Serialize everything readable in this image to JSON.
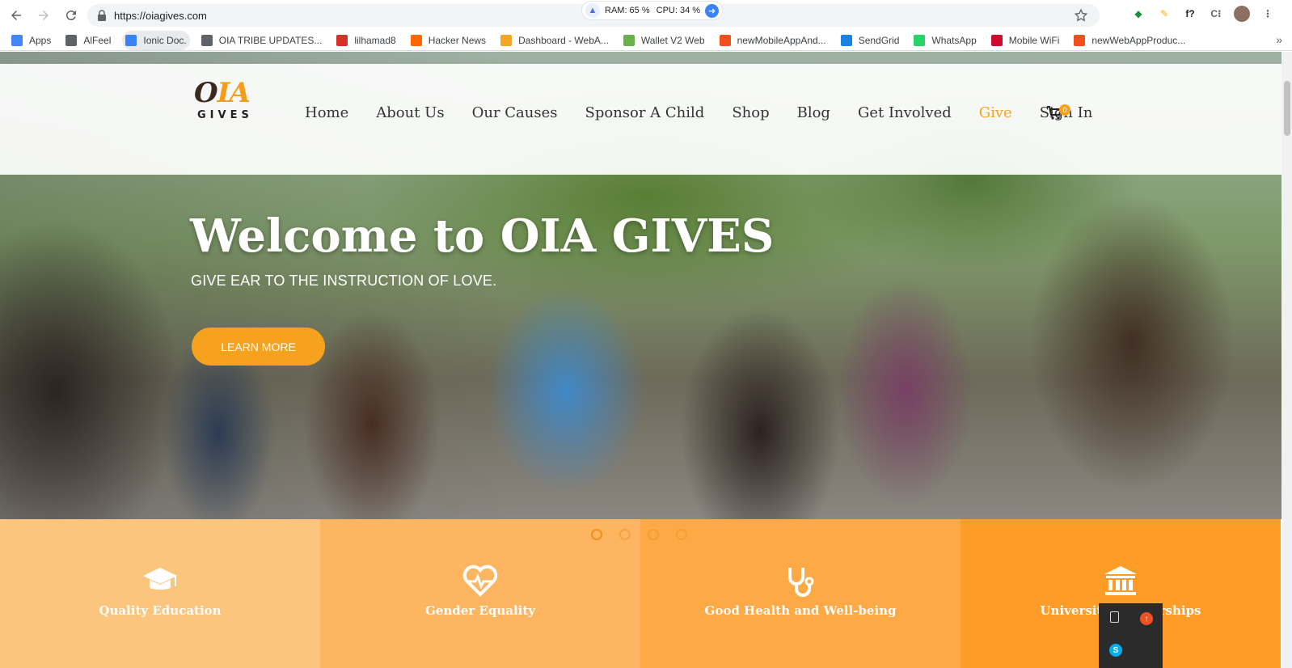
{
  "browser": {
    "url": "https://oiagives.com",
    "sysmon": {
      "ram": "RAM: 65 %",
      "cpu": "CPU: 34 %"
    },
    "bookmarks": [
      {
        "label": "Apps",
        "icon": "apps-grid-icon",
        "color": "#4285f4"
      },
      {
        "label": "AlFeel",
        "icon": "page-icon",
        "color": "#5f6368"
      },
      {
        "label": "Ionic Doc.",
        "icon": "chrome-icon",
        "color": "#3b82f6"
      },
      {
        "label": "OIA TRIBE UPDATES...",
        "icon": "page-icon",
        "color": "#5f6368"
      },
      {
        "label": "lilhamad8",
        "icon": "gmail-icon",
        "color": "#d93025"
      },
      {
        "label": "Hacker News",
        "icon": "y-combinator-icon",
        "color": "#ff6600"
      },
      {
        "label": "Dashboard - WebA...",
        "icon": "dashboard-icon",
        "color": "#f5a623"
      },
      {
        "label": "Wallet V2 Web",
        "icon": "wallet-icon",
        "color": "#6ab04c"
      },
      {
        "label": "newMobileAppAnd...",
        "icon": "figma-icon",
        "color": "#f24e1e"
      },
      {
        "label": "SendGrid",
        "icon": "sendgrid-icon",
        "color": "#1a82e2"
      },
      {
        "label": "WhatsApp",
        "icon": "whatsapp-icon",
        "color": "#25d366"
      },
      {
        "label": "Mobile WiFi",
        "icon": "huawei-icon",
        "color": "#cf0a2c"
      },
      {
        "label": "newWebAppProduc...",
        "icon": "figma-icon",
        "color": "#f24e1e"
      }
    ],
    "extensions": [
      {
        "icon": "extension-green-icon",
        "glyph": "◆",
        "color": "#1e8e3e"
      },
      {
        "icon": "extension-color-icon",
        "glyph": "✎",
        "color": "#f4b400"
      },
      {
        "icon": "font-icon",
        "glyph": "f?",
        "color": "#202124"
      },
      {
        "icon": "cs-icon",
        "glyph": "C⁝",
        "color": "#5f6368"
      }
    ]
  },
  "site": {
    "logo": {
      "mark": "IA",
      "word": "GIVES"
    },
    "nav": [
      {
        "label": "Home",
        "active": false
      },
      {
        "label": "About Us",
        "active": false
      },
      {
        "label": "Our Causes",
        "active": false
      },
      {
        "label": "Sponsor A Child",
        "active": false
      },
      {
        "label": "Shop",
        "active": false
      },
      {
        "label": "Blog",
        "active": false
      },
      {
        "label": "Get Involved",
        "active": false
      },
      {
        "label": "Give",
        "active": true
      },
      {
        "label": "Sign In",
        "active": false
      }
    ],
    "cart_count": "0",
    "accent": "#f7a21e"
  },
  "hero": {
    "title": "Welcome to OIA GIVES",
    "subtitle": "GIVE EAR TO THE INSTRUCTION OF LOVE.",
    "cta": "LEARN MORE",
    "slide_count": 4,
    "active_slide": 1
  },
  "features": [
    {
      "label": "Quality Education",
      "icon": "graduation-cap-icon"
    },
    {
      "label": "Gender Equality",
      "icon": "heart-pulse-icon"
    },
    {
      "label": "Good Health and Well-being",
      "icon": "stethoscope-icon"
    },
    {
      "label": "University Scholarships",
      "icon": "institution-icon"
    }
  ]
}
